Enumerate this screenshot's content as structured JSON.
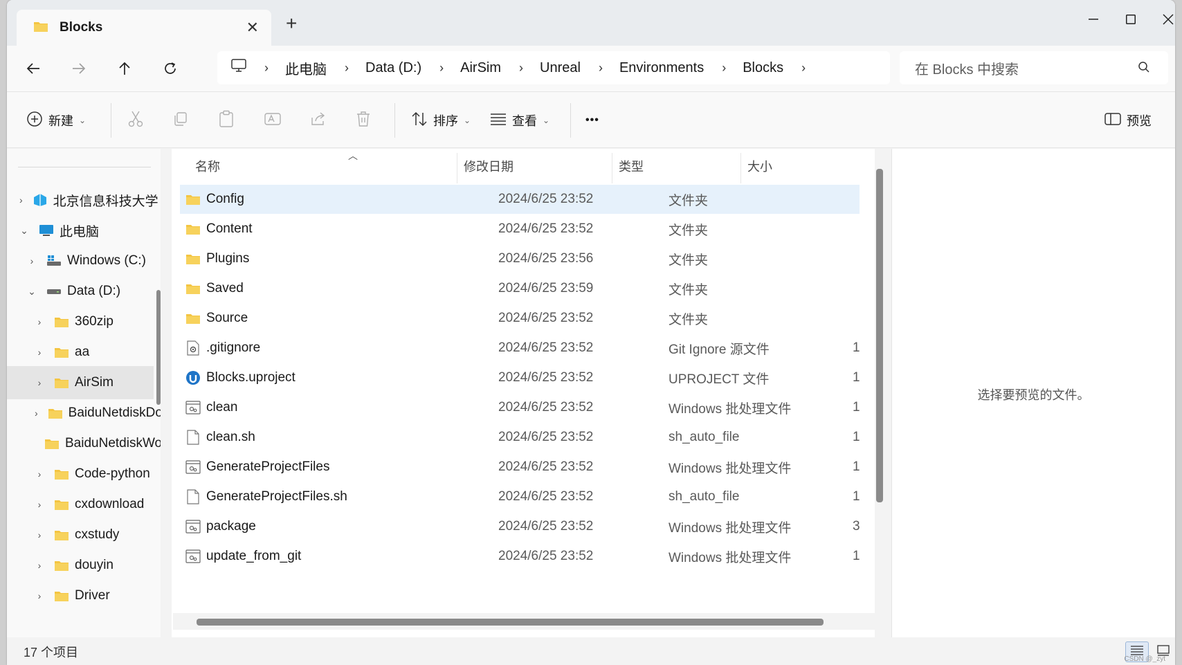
{
  "tab": {
    "title": "Blocks",
    "close": "✕"
  },
  "new_tab": "+",
  "address": {
    "breadcrumbs": [
      "此电脑",
      "Data (D:)",
      "AirSim",
      "Unreal",
      "Environments",
      "Blocks"
    ],
    "separator": "›"
  },
  "search": {
    "placeholder": "在 Blocks 中搜索"
  },
  "toolbar": {
    "new_label": "新建",
    "sort_label": "排序",
    "view_label": "查看",
    "more_label": "•••",
    "preview_label": "预览"
  },
  "sidebar": {
    "items": [
      {
        "label": "北京信息科技大学",
        "chevron": "›",
        "icon": "cloud"
      },
      {
        "label": "此电脑",
        "chevron": "⌄",
        "icon": "pc"
      },
      {
        "label": "Windows (C:)",
        "chevron": "›",
        "icon": "win-drive"
      },
      {
        "label": "Data (D:)",
        "chevron": "⌄",
        "icon": "drive"
      },
      {
        "label": "360zip",
        "chevron": "›",
        "icon": "folder"
      },
      {
        "label": "aa",
        "chevron": "›",
        "icon": "folder"
      },
      {
        "label": "AirSim",
        "chevron": "›",
        "icon": "folder",
        "selected": true
      },
      {
        "label": "BaiduNetdiskDownload",
        "chevron": "›",
        "icon": "folder"
      },
      {
        "label": "BaiduNetdiskWorkspace",
        "chevron": "",
        "icon": "folder"
      },
      {
        "label": "Code-python",
        "chevron": "›",
        "icon": "folder"
      },
      {
        "label": "cxdownload",
        "chevron": "›",
        "icon": "folder"
      },
      {
        "label": "cxstudy",
        "chevron": "›",
        "icon": "folder"
      },
      {
        "label": "douyin",
        "chevron": "›",
        "icon": "folder"
      },
      {
        "label": "Driver",
        "chevron": "›",
        "icon": "folder"
      }
    ]
  },
  "columns": {
    "name": "名称",
    "date": "修改日期",
    "type": "类型",
    "size": "大小"
  },
  "files": [
    {
      "name": "Config",
      "date": "2024/6/25 23:52",
      "type": "文件夹",
      "size": "",
      "icon": "folder",
      "selected": true
    },
    {
      "name": "Content",
      "date": "2024/6/25 23:52",
      "type": "文件夹",
      "size": "",
      "icon": "folder"
    },
    {
      "name": "Plugins",
      "date": "2024/6/25 23:56",
      "type": "文件夹",
      "size": "",
      "icon": "folder"
    },
    {
      "name": "Saved",
      "date": "2024/6/25 23:59",
      "type": "文件夹",
      "size": "",
      "icon": "folder"
    },
    {
      "name": "Source",
      "date": "2024/6/25 23:52",
      "type": "文件夹",
      "size": "",
      "icon": "folder"
    },
    {
      "name": ".gitignore",
      "date": "2024/6/25 23:52",
      "type": "Git Ignore 源文件",
      "size": "1",
      "icon": "config-file"
    },
    {
      "name": "Blocks.uproject",
      "date": "2024/6/25 23:52",
      "type": "UPROJECT 文件",
      "size": "1",
      "icon": "unreal"
    },
    {
      "name": "clean",
      "date": "2024/6/25 23:52",
      "type": "Windows 批处理文件",
      "size": "1",
      "icon": "batch"
    },
    {
      "name": "clean.sh",
      "date": "2024/6/25 23:52",
      "type": "sh_auto_file",
      "size": "1",
      "icon": "file"
    },
    {
      "name": "GenerateProjectFiles",
      "date": "2024/6/25 23:52",
      "type": "Windows 批处理文件",
      "size": "1",
      "icon": "batch"
    },
    {
      "name": "GenerateProjectFiles.sh",
      "date": "2024/6/25 23:52",
      "type": "sh_auto_file",
      "size": "1",
      "icon": "file"
    },
    {
      "name": "package",
      "date": "2024/6/25 23:52",
      "type": "Windows 批处理文件",
      "size": "3",
      "icon": "batch"
    },
    {
      "name": "update_from_git",
      "date": "2024/6/25 23:52",
      "type": "Windows 批处理文件",
      "size": "1",
      "icon": "batch"
    }
  ],
  "preview": {
    "message": "选择要预览的文件。"
  },
  "status": {
    "item_count": "17 个项目"
  },
  "watermark": "CSDN @_zyt",
  "colors": {
    "selection": "#e6f1fb",
    "folder": "#f4c542",
    "accent": "#0067c0"
  }
}
